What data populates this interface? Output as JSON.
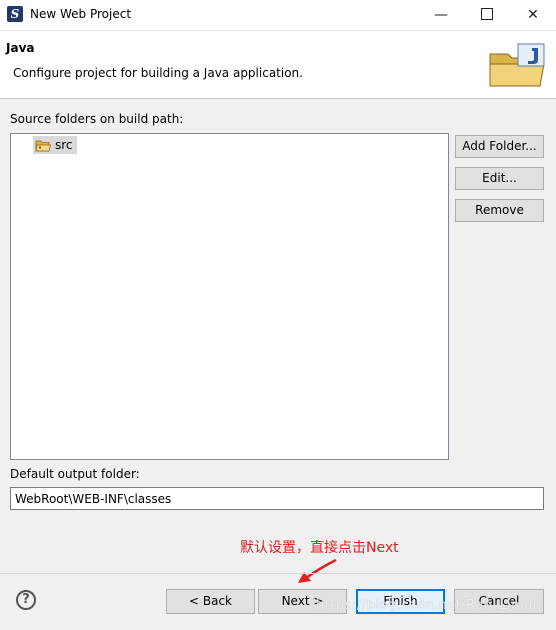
{
  "window": {
    "title": "New Web Project",
    "controls": {
      "minimize": "—",
      "close": "✕"
    }
  },
  "banner": {
    "title": "Java",
    "description": "Configure project for building a Java application."
  },
  "source_folders": {
    "label": "Source folders on build path:",
    "items": [
      {
        "label": "src"
      }
    ],
    "buttons": {
      "add": "Add Folder...",
      "edit": "Edit...",
      "remove": "Remove"
    }
  },
  "output": {
    "label": "Default output folder:",
    "value": "WebRoot\\WEB-INF\\classes"
  },
  "annotation": {
    "text": "默认设置，直接点击Next",
    "color": "#e02020"
  },
  "footer": {
    "help": "?",
    "back": "< Back",
    "next": "Next >",
    "finish": "Finish",
    "cancel": "Cancel"
  },
  "watermark": "https://blog.csdn.net/Rao_Limon",
  "colors": {
    "accent": "#0078d7",
    "annotation": "#e02020"
  }
}
